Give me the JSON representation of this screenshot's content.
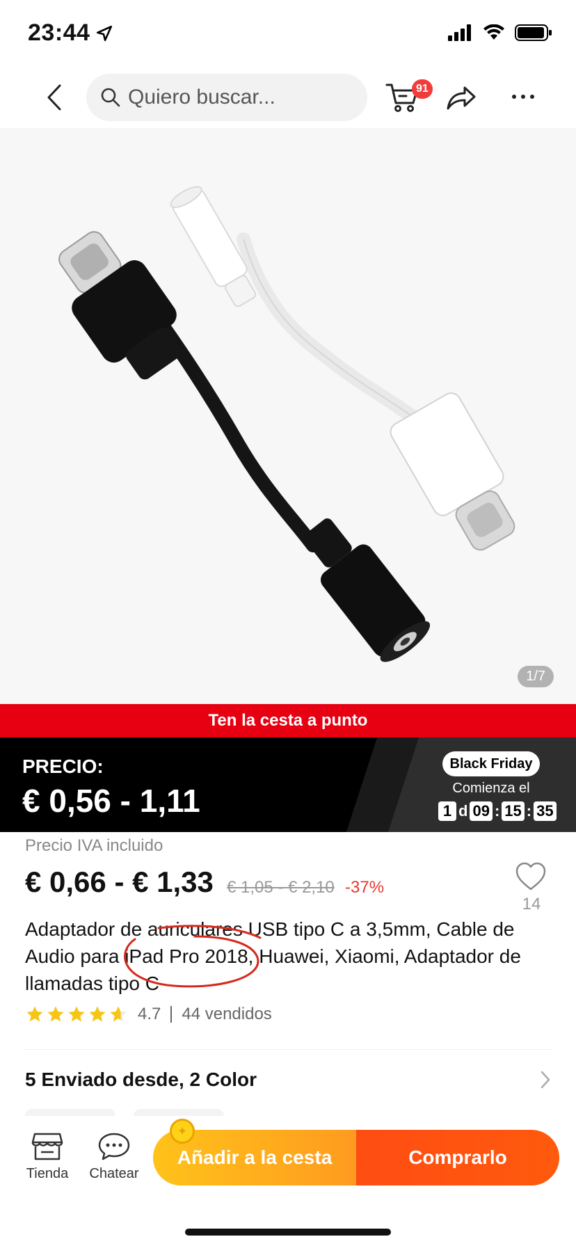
{
  "status_bar": {
    "time": "23:44"
  },
  "nav": {
    "search_placeholder": "Quiero buscar...",
    "cart_count": "91"
  },
  "gallery": {
    "counter": "1/7"
  },
  "promo_banner": "Ten la cesta a punto",
  "price_strip": {
    "label": "PRECIO:",
    "range": "€ 0,56 - 1,11",
    "event_badge": "Black Friday",
    "begins_label": "Comienza el",
    "countdown": {
      "days": "1",
      "days_unit": "d",
      "hours": "09",
      "minutes": "15",
      "seconds": "35"
    }
  },
  "details": {
    "vat_note": "Precio IVA incluido",
    "price": "€ 0,66 - € 1,33",
    "old_price": "€ 1,05 - € 2,10",
    "discount": "-37%",
    "wishlist_count": "14",
    "title": "Adaptador de auriculares USB tipo C a 3,5mm, Cable de Audio para iPad Pro 2018, Huawei, Xiaomi, Adaptador de llamadas tipo C",
    "rating": "4.7",
    "rating_stars": 4.7,
    "sold": "44 vendidos",
    "shipping": "5 Enviado desde, 2 Color"
  },
  "bottom_bar": {
    "store_label": "Tienda",
    "chat_label": "Chatear",
    "add_to_cart": "Añadir a la cesta",
    "buy_now": "Comprarlo"
  },
  "colors": {
    "promo_red": "#e60012",
    "discount_red": "#e8382f",
    "star_yellow": "#f7c518",
    "cta_orange": "#ff9b1f",
    "cta_red": "#ff4d12"
  }
}
